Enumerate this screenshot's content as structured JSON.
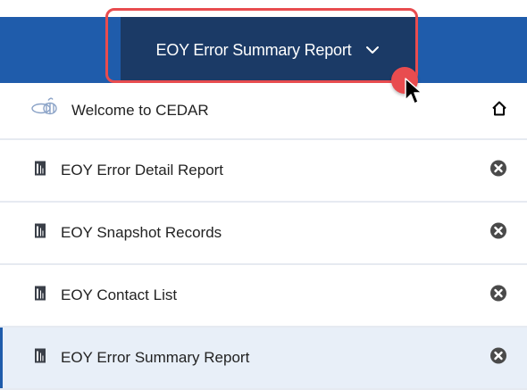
{
  "header": {
    "active_tab_label": "EOY Error Summary Report"
  },
  "menu": {
    "items": [
      {
        "label": "Welcome to CEDAR",
        "icon": "bee-logo-icon",
        "right_icon": "home-icon"
      },
      {
        "label": "EOY Error Detail Report",
        "icon": "report-icon",
        "right_icon": "close-icon"
      },
      {
        "label": "EOY Snapshot Records",
        "icon": "report-icon",
        "right_icon": "close-icon"
      },
      {
        "label": "EOY Contact List",
        "icon": "report-icon",
        "right_icon": "close-icon"
      },
      {
        "label": "EOY Error Summary Report",
        "icon": "report-icon",
        "right_icon": "close-icon",
        "active": true
      }
    ]
  },
  "colors": {
    "header_blue": "#1f5cab",
    "tab_dark": "#1b3a66",
    "highlight_red": "#e84c4f",
    "active_row_bg": "#e8eff8"
  }
}
